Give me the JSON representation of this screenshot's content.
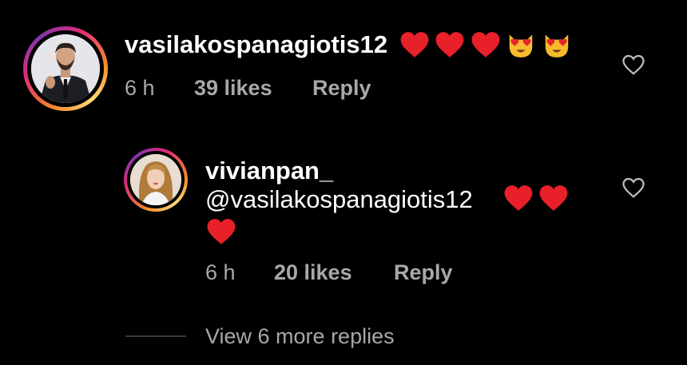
{
  "comment": {
    "username": "vasilakospanagiotis12",
    "emojis": [
      "red-heart",
      "red-heart",
      "red-heart",
      "heart-eyes-cat",
      "heart-eyes-cat"
    ],
    "time": "6 h",
    "likes": "39 likes",
    "reply_label": "Reply"
  },
  "reply": {
    "username": "vivianpan_",
    "mention": "@vasilakospanagiotis12",
    "emojis_line1": [
      "red-heart",
      "red-heart"
    ],
    "emojis_line2": [
      "red-heart"
    ],
    "time": "6 h",
    "likes": "20 likes",
    "reply_label": "Reply"
  },
  "view_replies": "View 6 more replies",
  "colors": {
    "background": "#000000",
    "text": "#ffffff",
    "secondary_text": "#a8a8a8",
    "heart": "#e8202a",
    "divider": "#3a3a3a"
  }
}
